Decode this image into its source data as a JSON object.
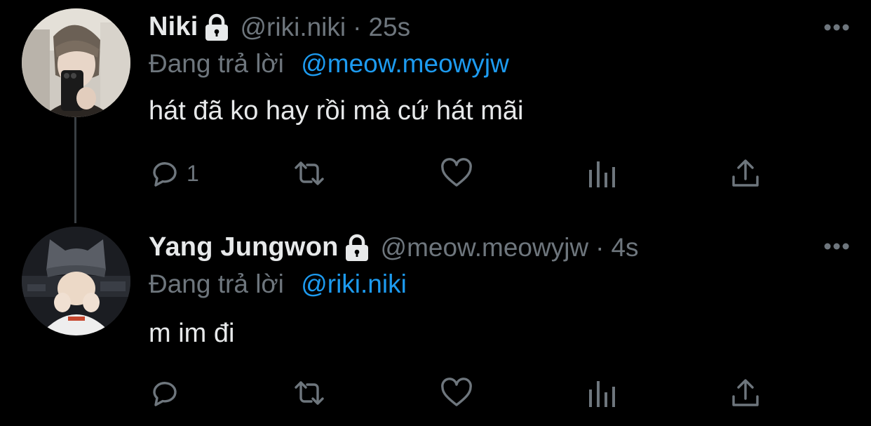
{
  "tweets": [
    {
      "display_name": "Niki",
      "handle": "@riki.niki",
      "separator": "·",
      "time": "25s",
      "reply_prefix": "Đang trả lời",
      "reply_to": "@meow.meowyjw",
      "text": "hát đã ko hay rồi mà cứ hát mãi",
      "reply_count": "1",
      "icons": [
        "lock-icon",
        "more-icon",
        "reply-icon",
        "retweet-icon",
        "like-icon",
        "views-icon",
        "share-icon"
      ]
    },
    {
      "display_name": "Yang Jungwon",
      "handle": "@meow.meowyjw",
      "separator": "·",
      "time": "4s",
      "reply_prefix": "Đang trả lời",
      "reply_to": "@riki.niki",
      "text": "m im đi",
      "reply_count": "",
      "icons": [
        "lock-icon",
        "more-icon",
        "reply-icon",
        "retweet-icon",
        "like-icon",
        "views-icon",
        "share-icon"
      ]
    }
  ],
  "colors": {
    "background": "#000000",
    "primary_text": "#e7e9ea",
    "secondary_text": "#6e767d",
    "mention": "#1d9bf0",
    "thread_line": "#3a3f44"
  }
}
